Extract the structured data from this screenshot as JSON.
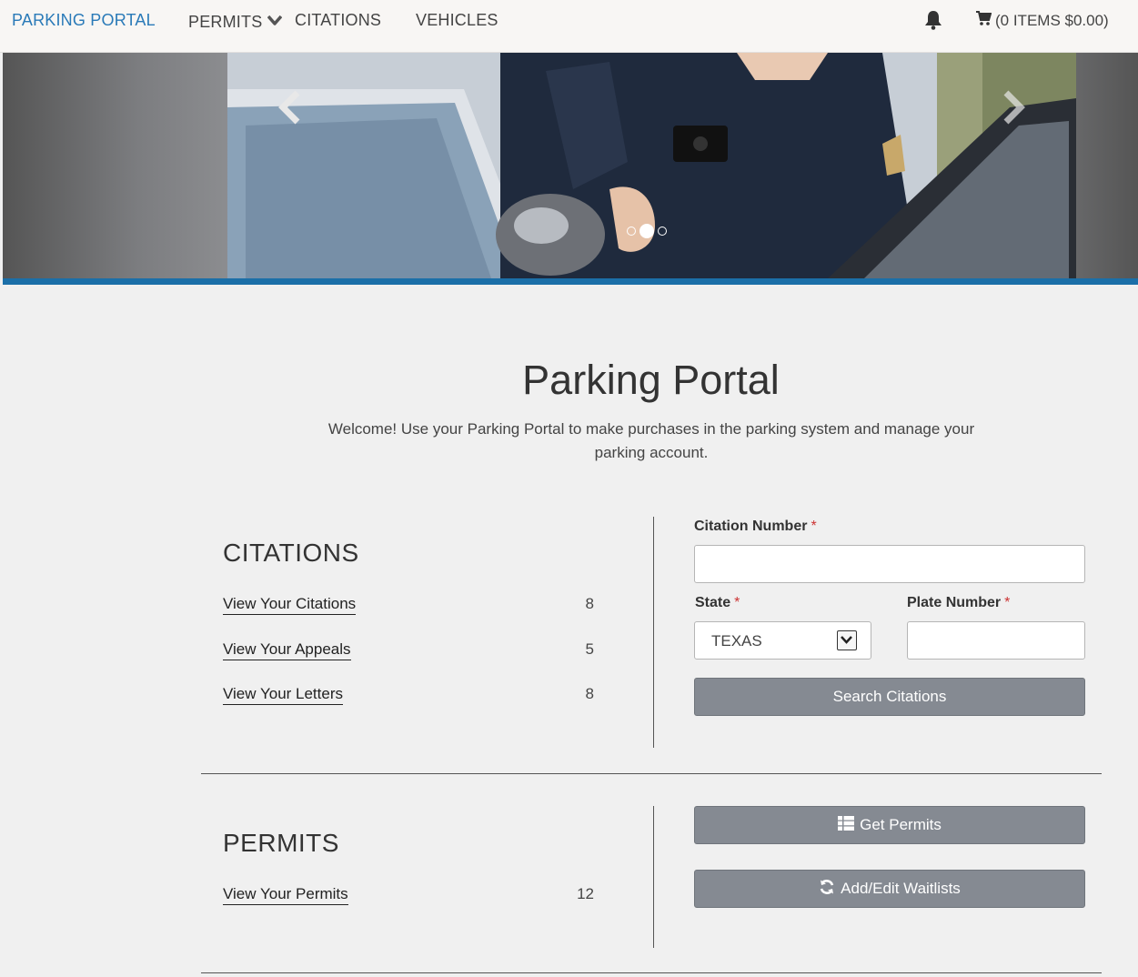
{
  "nav": {
    "brand": "PARKING PORTAL",
    "links": [
      "PERMITS",
      "CITATIONS",
      "VEHICLES"
    ],
    "cart_label": "(0 ITEMS $0.00)"
  },
  "colors": {
    "brand_blue": "#2a7ab8",
    "hero_bar": "#1b6fa8",
    "button_gray": "#858a92",
    "required_red": "#cc3333"
  },
  "hero": {
    "slide_count": 3,
    "active_slide": 2
  },
  "main": {
    "title": "Parking Portal",
    "welcome": "Welcome! Use your Parking Portal to make purchases in the parking system and manage your parking account."
  },
  "citations": {
    "heading": "CITATIONS",
    "links": [
      {
        "label": "View Your Citations",
        "count": "8"
      },
      {
        "label": "View Your Appeals",
        "count": "5"
      },
      {
        "label": "View Your Letters",
        "count": "8"
      }
    ],
    "form": {
      "citation_number_label": "Citation Number",
      "citation_number_value": "",
      "state_label": "State",
      "state_value": "TEXAS",
      "plate_number_label": "Plate Number",
      "plate_number_value": "",
      "required_mark": "*",
      "search_button": "Search Citations"
    }
  },
  "permits": {
    "heading": "PERMITS",
    "links": [
      {
        "label": "View Your Permits",
        "count": "12"
      }
    ],
    "get_permits_button": "Get Permits",
    "waitlists_button": "Add/Edit Waitlists"
  },
  "icons": {
    "nav_permits_chevron": "chevron-down-icon",
    "bell": "bell-icon",
    "cart": "cart-icon",
    "prev": "chevron-left-icon",
    "next": "chevron-right-icon",
    "get_permits": "grid-list-icon",
    "waitlists": "refresh-icon",
    "select_arrow": "chevron-down-icon"
  }
}
